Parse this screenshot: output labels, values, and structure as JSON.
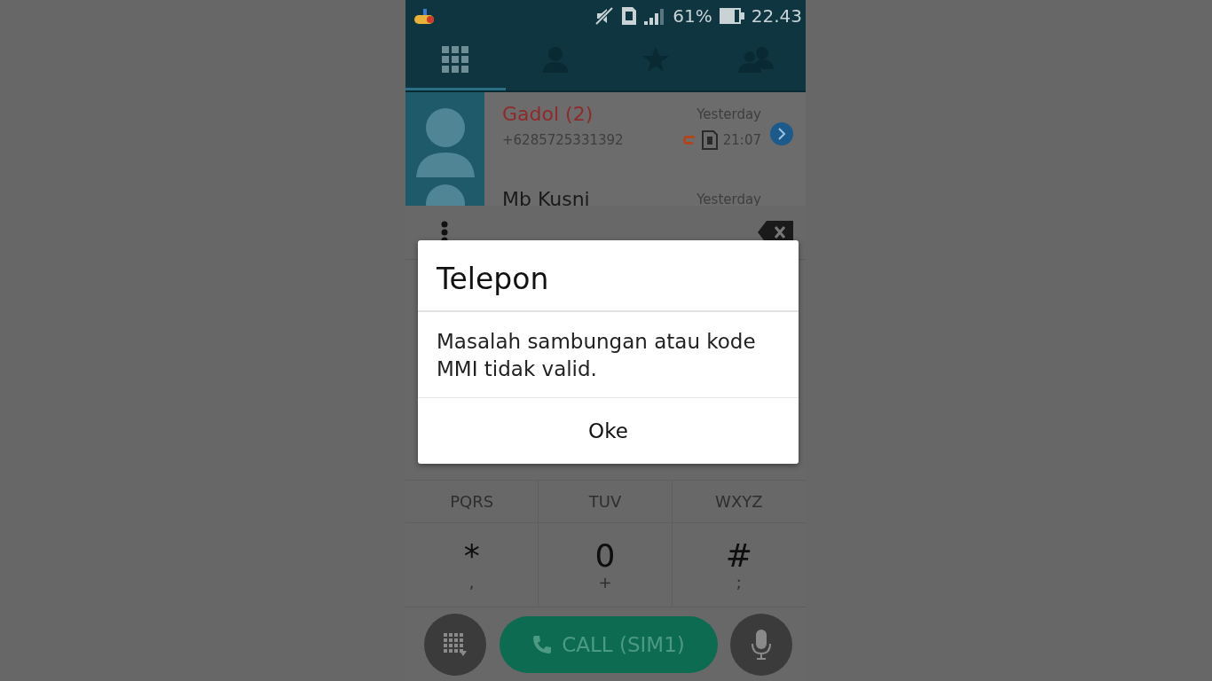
{
  "status_bar": {
    "battery": "61%",
    "time": "22.43"
  },
  "tabs": [
    {
      "kind": "dialpad",
      "selected": true
    },
    {
      "kind": "contacts",
      "selected": false
    },
    {
      "kind": "favorites",
      "selected": false
    },
    {
      "kind": "groups",
      "selected": false
    }
  ],
  "call_log": [
    {
      "name": "Gadol (2)",
      "missed": true,
      "number": "+6285725331392",
      "date": "Yesterday",
      "time": "21:07"
    },
    {
      "name": "Mb Kusni",
      "missed": false,
      "date": "Yesterday"
    }
  ],
  "keypad": [
    {
      "letters": "PQRS"
    },
    {
      "letters": "TUV"
    },
    {
      "letters": "WXYZ"
    },
    {
      "digit": "*",
      "letters": ","
    },
    {
      "digit": "0",
      "letters": "+"
    },
    {
      "digit": "#",
      "letters": ";"
    }
  ],
  "call_button": "CALL (SIM1)",
  "dialog": {
    "title": "Telepon",
    "message": "Masalah sambungan atau kode MMI tidak valid.",
    "button": "Oke"
  }
}
